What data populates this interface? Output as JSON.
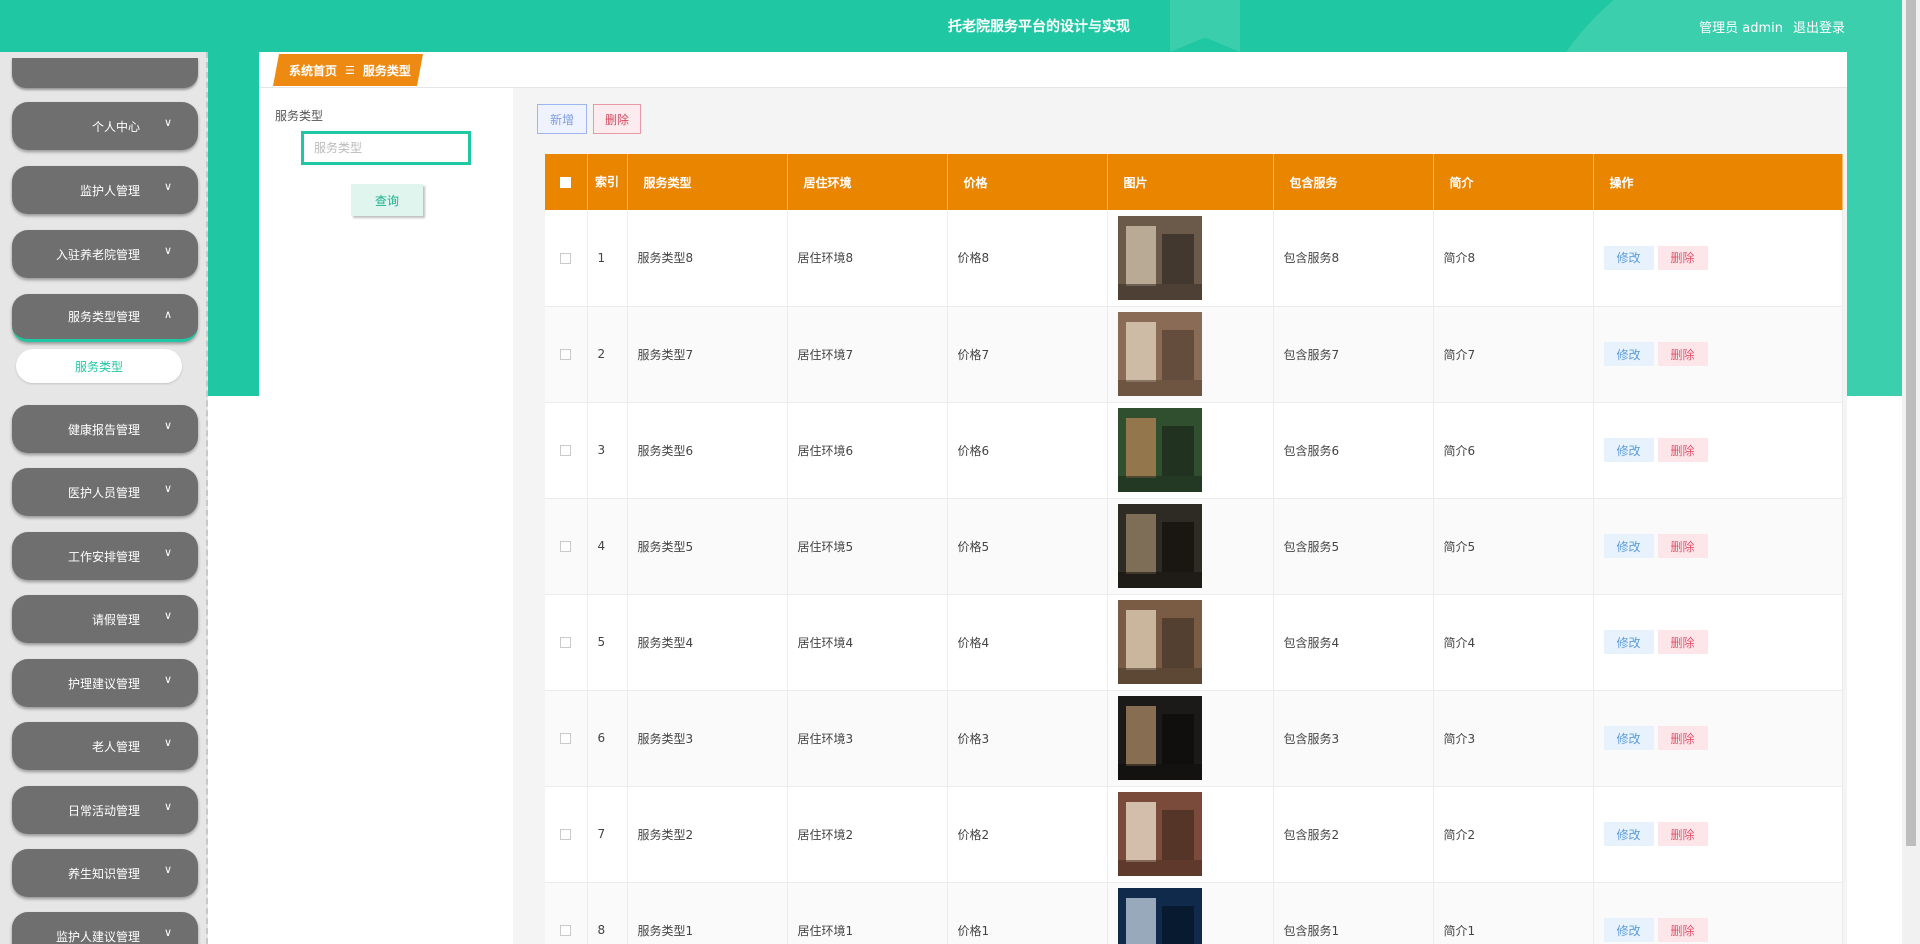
{
  "header": {
    "title": "托老院服务平台的设计与实现",
    "role_label": "管理员 admin",
    "logout_label": "退出登录"
  },
  "sidebar": {
    "items": [
      {
        "label": "个人中心"
      },
      {
        "label": "监护人管理"
      },
      {
        "label": "入驻养老院管理"
      },
      {
        "label": "服务类型管理",
        "expanded": true
      },
      {
        "label": "健康报告管理"
      },
      {
        "label": "医护人员管理"
      },
      {
        "label": "工作安排管理"
      },
      {
        "label": "请假管理"
      },
      {
        "label": "护理建议管理"
      },
      {
        "label": "老人管理"
      },
      {
        "label": "日常活动管理"
      },
      {
        "label": "养生知识管理"
      },
      {
        "label": "监护人建议管理"
      }
    ],
    "sub_item": "服务类型"
  },
  "breadcrumb": {
    "home": "系统首页",
    "separator": "☰",
    "current": "服务类型"
  },
  "search": {
    "label": "服务类型",
    "placeholder": "服务类型",
    "button": "查询"
  },
  "toolbar": {
    "add_label": "新增",
    "delete_label": "删除"
  },
  "table": {
    "headers": {
      "index": "索引",
      "type": "服务类型",
      "env": "居住环境",
      "price": "价格",
      "image": "图片",
      "services": "包含服务",
      "intro": "简介",
      "ops": "操作"
    },
    "edit_label": "修改",
    "delete_label": "删除",
    "rows": [
      {
        "index": "1",
        "type": "服务类型8",
        "env": "居住环境8",
        "price": "价格8",
        "services": "包含服务8",
        "intro": "简介8"
      },
      {
        "index": "2",
        "type": "服务类型7",
        "env": "居住环境7",
        "price": "价格7",
        "services": "包含服务7",
        "intro": "简介7"
      },
      {
        "index": "3",
        "type": "服务类型6",
        "env": "居住环境6",
        "price": "价格6",
        "services": "包含服务6",
        "intro": "简介6"
      },
      {
        "index": "4",
        "type": "服务类型5",
        "env": "居住环境5",
        "price": "价格5",
        "services": "包含服务5",
        "intro": "简介5"
      },
      {
        "index": "5",
        "type": "服务类型4",
        "env": "居住环境4",
        "price": "价格4",
        "services": "包含服务4",
        "intro": "简介4"
      },
      {
        "index": "6",
        "type": "服务类型3",
        "env": "居住环境3",
        "price": "价格3",
        "services": "包含服务3",
        "intro": "简介3"
      },
      {
        "index": "7",
        "type": "服务类型2",
        "env": "居住环境2",
        "price": "价格2",
        "services": "包含服务2",
        "intro": "简介2"
      },
      {
        "index": "8",
        "type": "服务类型1",
        "env": "居住环境1",
        "price": "价格1",
        "services": "包含服务1",
        "intro": "简介1"
      }
    ]
  },
  "colors": {
    "brand": "#1fc8a2",
    "table_header": "#ea8500",
    "breadcrumb": "#ee8a12",
    "sidebar_item": "#6f6f6f"
  }
}
